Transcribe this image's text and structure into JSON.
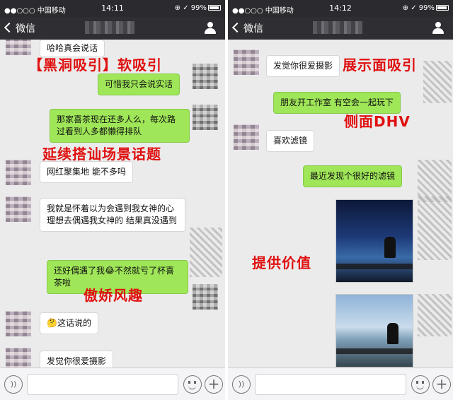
{
  "left": {
    "status": {
      "carrier": "●●○○○ 中国移动",
      "time": "14:11",
      "battery": "⊕ ✓ 99%"
    },
    "nav": {
      "back_label": "微信"
    },
    "messages": [
      {
        "side": "in",
        "text": "哈哈真会说话"
      },
      {
        "side": "out",
        "text": "可惜我只会说实话"
      },
      {
        "side": "out",
        "text": "那家喜茶现在还多人么，每次路过看到人多都懒得排队"
      },
      {
        "side": "in",
        "text": "网红聚集地 能不多吗"
      },
      {
        "side": "in",
        "text": "我就是怀着以为会遇到我女神的心理想去偶遇我女神的  结果真没遇到"
      },
      {
        "side": "out",
        "text": "还好偶遇了我😂不然就亏了杯喜茶啦"
      },
      {
        "side": "in",
        "text": "🤔这话说的"
      },
      {
        "side": "in",
        "text": "发觉你很爱摄影"
      }
    ],
    "annotations": [
      "【黑洞吸引】软吸引",
      "延续搭讪场景话题",
      "傲娇风趣"
    ]
  },
  "right": {
    "status": {
      "carrier": "●●○○○ 中国移动",
      "time": "14:12",
      "battery": "⊕ ✓ 99%"
    },
    "nav": {
      "back_label": "微信"
    },
    "messages": [
      {
        "side": "in",
        "text": "发觉你很爱摄影"
      },
      {
        "side": "out",
        "text": "朋友开工作室 有空会一起玩下"
      },
      {
        "side": "in",
        "text": "喜欢滤镜"
      },
      {
        "side": "out",
        "text": "最近发现个很好的滤镜"
      }
    ],
    "annotations": [
      "展示面吸引",
      "侧面DHV",
      "提供价值"
    ]
  },
  "colors": {
    "out_bubble": "#9fe658",
    "in_bubble": "#ffffff",
    "annotation": "#e01010",
    "nav": "#2e2e33"
  }
}
